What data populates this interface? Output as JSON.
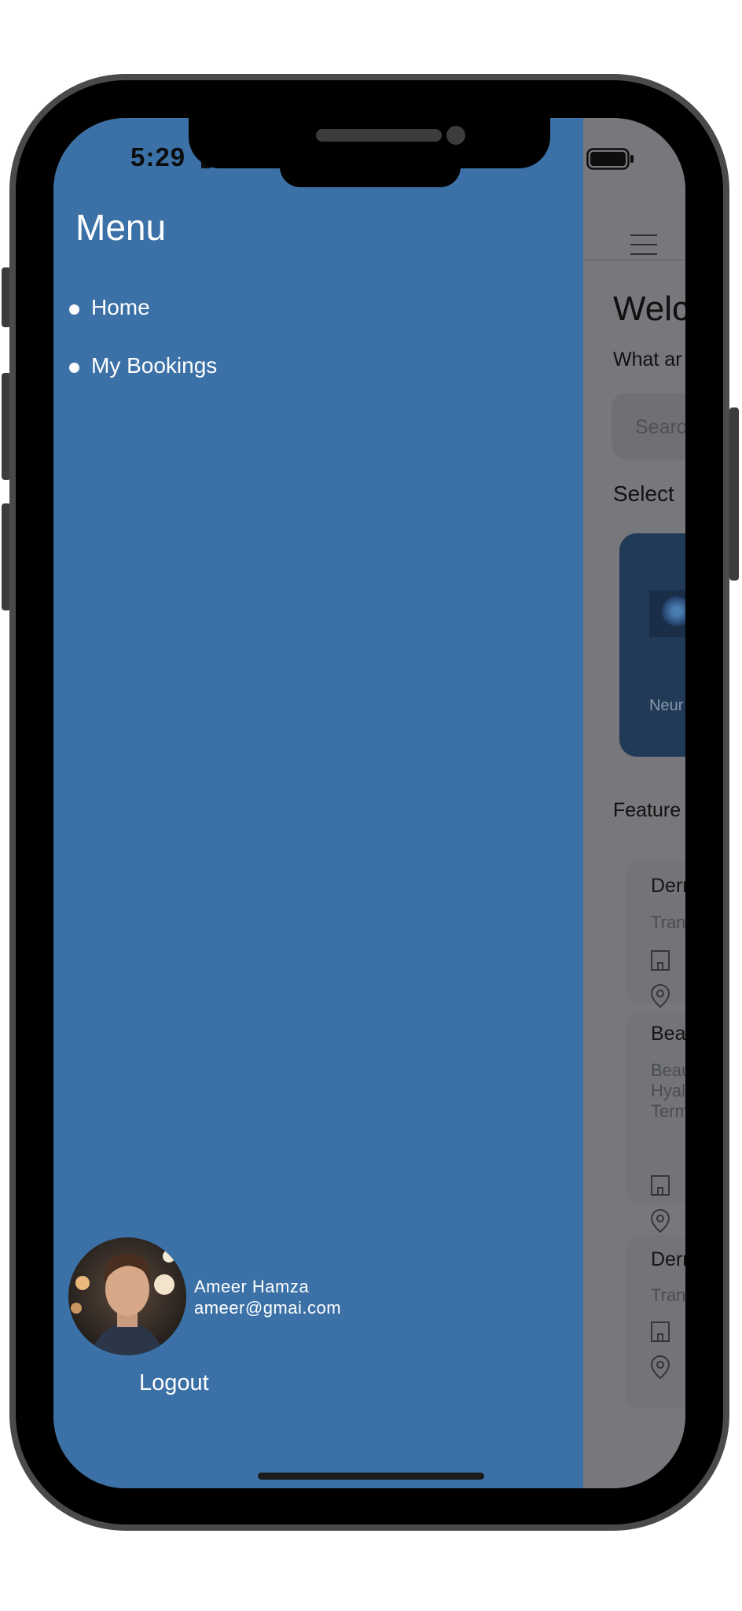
{
  "status_bar": {
    "time": "5:29"
  },
  "drawer": {
    "title": "Menu",
    "items": [
      {
        "label": "Home"
      },
      {
        "label": "My Bookings"
      }
    ],
    "user": {
      "name": "Ameer Hamza",
      "email": "ameer@gmai.com"
    },
    "logout_label": "Logout"
  },
  "background_screen": {
    "welcome_fragment": "Welc",
    "subtitle_fragment": "What ar",
    "search_placeholder_fragment": "Searc",
    "select_label_fragment": "Select",
    "category_card": {
      "label_fragment": "Neur"
    },
    "featured_label_fragment": "Feature",
    "featured_cards": [
      {
        "title_fragment": "Derr",
        "sub_lines": [
          "Tran"
        ]
      },
      {
        "title_fragment": "Bea",
        "sub_lines": [
          "Beau",
          "Hyal",
          "Term"
        ]
      },
      {
        "title_fragment": "Derr",
        "sub_lines": [
          "Tran"
        ]
      }
    ]
  }
}
